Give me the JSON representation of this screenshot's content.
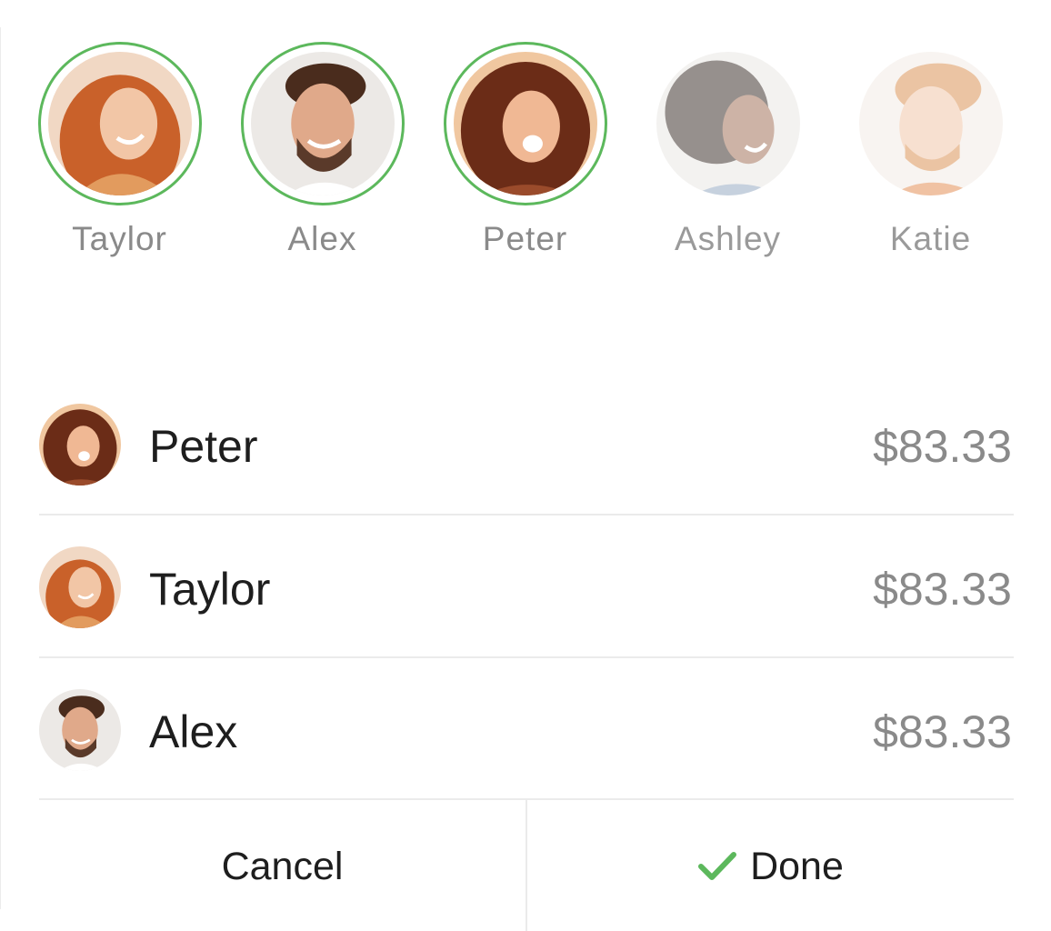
{
  "picker": {
    "people": [
      {
        "name": "Taylor",
        "selected": true
      },
      {
        "name": "Alex",
        "selected": true
      },
      {
        "name": "Peter",
        "selected": true
      },
      {
        "name": "Ashley",
        "selected": false
      },
      {
        "name": "Katie",
        "selected": false
      }
    ]
  },
  "split": {
    "rows": [
      {
        "name": "Peter",
        "amount": "$83.33"
      },
      {
        "name": "Taylor",
        "amount": "$83.33"
      },
      {
        "name": "Alex",
        "amount": "$83.33"
      }
    ]
  },
  "actions": {
    "cancel_label": "Cancel",
    "done_label": "Done"
  },
  "colors": {
    "accent": "#5cb85c",
    "name_text": "#1e1e1e",
    "muted_text": "#8a8a8a",
    "divider": "#ebebeb"
  },
  "icons": {
    "done": "checkmark-icon"
  }
}
